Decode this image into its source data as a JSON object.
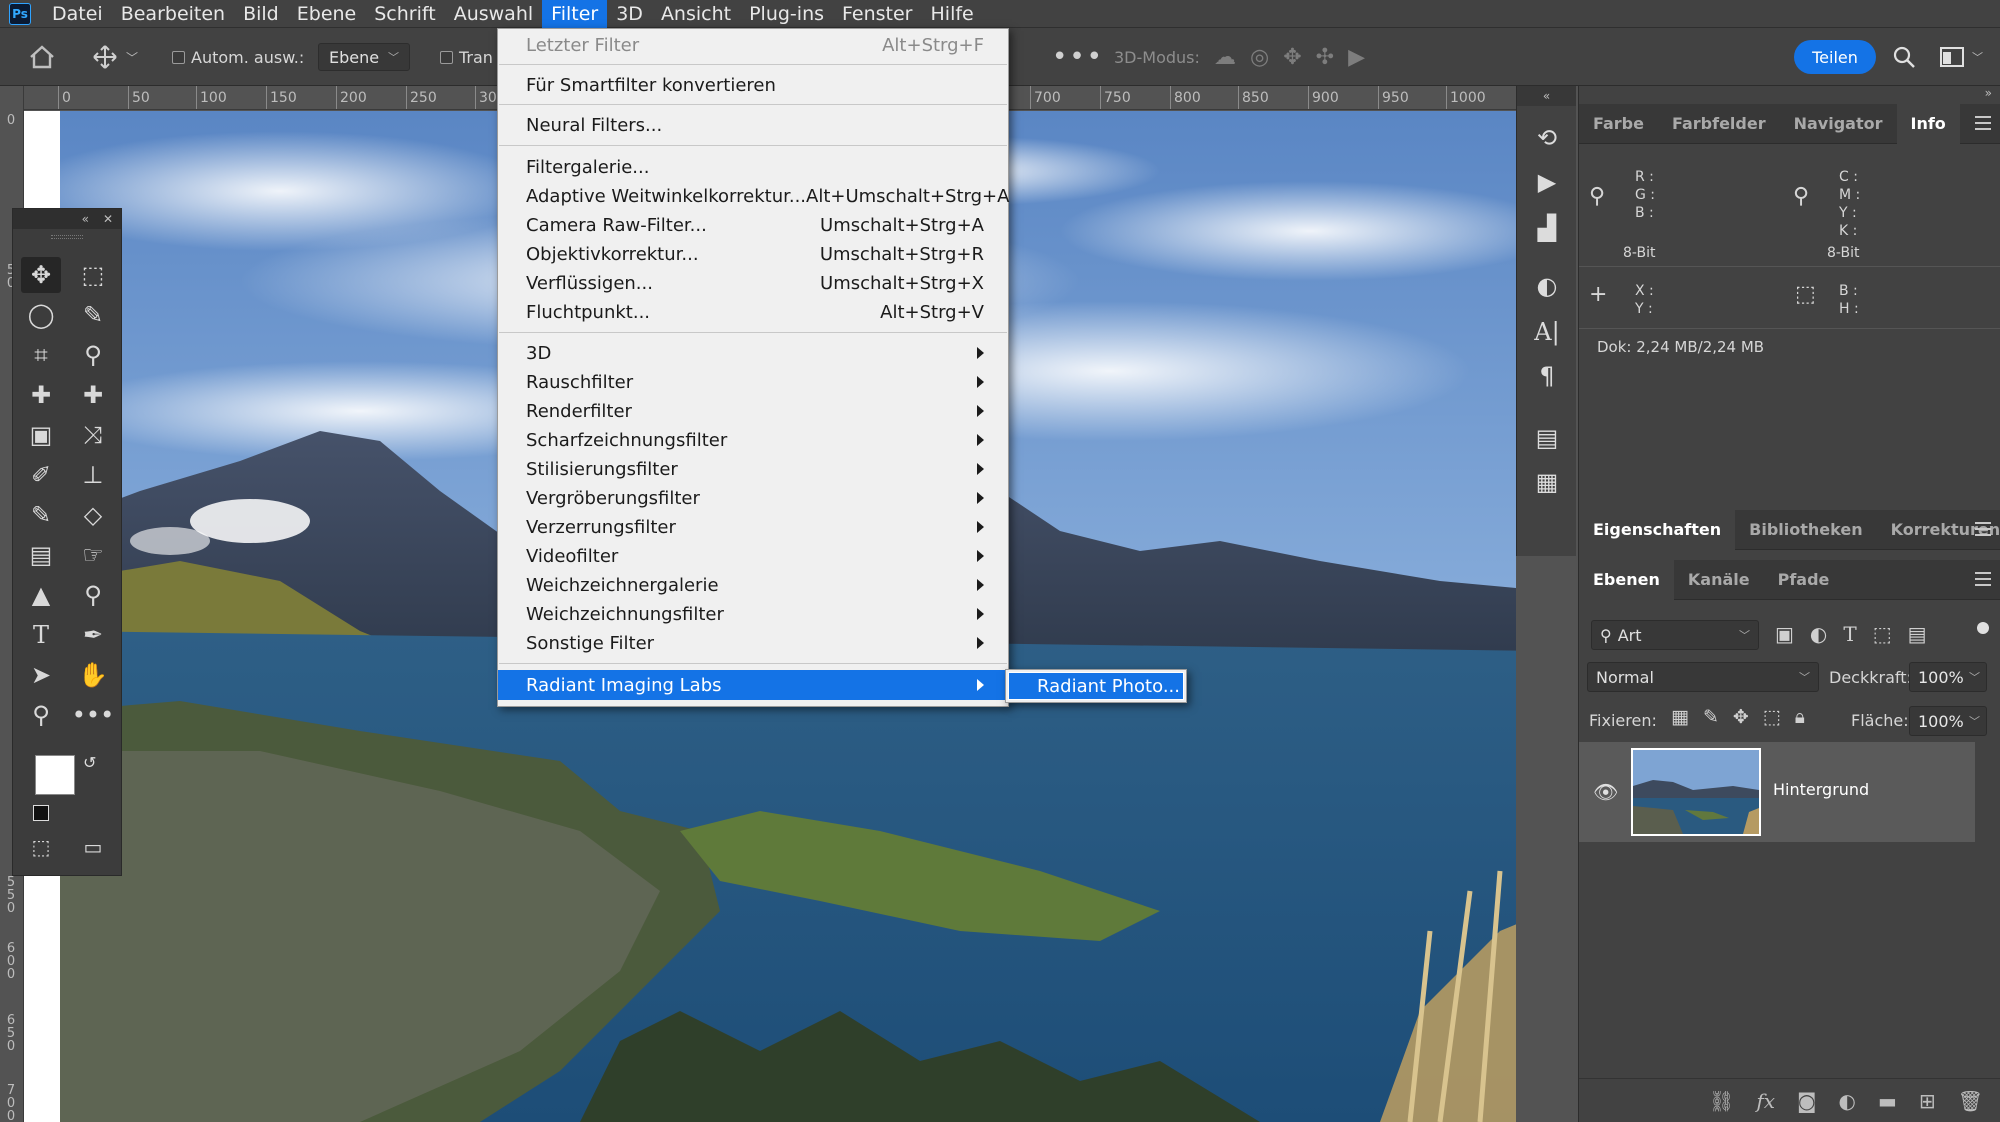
{
  "app": {
    "logo": "Ps"
  },
  "menubar": {
    "items": [
      "Datei",
      "Bearbeiten",
      "Bild",
      "Ebene",
      "Schrift",
      "Auswahl",
      "Filter",
      "3D",
      "Ansicht",
      "Plug-ins",
      "Fenster",
      "Hilfe"
    ],
    "active": "Filter"
  },
  "options": {
    "auto_select_label": "Autom. ausw.:",
    "layer_select": "Ebene",
    "transform_label": "Tran",
    "mode_label": "3D-Modus:",
    "share_label": "Teilen"
  },
  "ruler": {
    "top": [
      "0",
      "50",
      "100",
      "150",
      "200",
      "250",
      "30",
      "700",
      "750",
      "800",
      "850",
      "900",
      "950",
      "1000"
    ],
    "left": [
      "0",
      "50",
      "550",
      "600",
      "650",
      "700"
    ]
  },
  "filter_menu": {
    "items": [
      {
        "label": "Letzter Filter",
        "shortcut": "Alt+Strg+F",
        "disabled": true
      },
      {
        "label": "Für Smartfilter konvertieren",
        "shortcut": ""
      },
      {
        "label": "Neural Filters...",
        "shortcut": ""
      },
      {
        "label": "Filtergalerie...",
        "shortcut": ""
      },
      {
        "label": "Adaptive Weitwinkelkorrektur...",
        "shortcut": "Alt+Umschalt+Strg+A"
      },
      {
        "label": "Camera Raw-Filter...",
        "shortcut": "Umschalt+Strg+A"
      },
      {
        "label": "Objektivkorrektur...",
        "shortcut": "Umschalt+Strg+R"
      },
      {
        "label": "Verflüssigen...",
        "shortcut": "Umschalt+Strg+X"
      },
      {
        "label": "Fluchtpunkt...",
        "shortcut": "Alt+Strg+V"
      },
      {
        "label": "3D",
        "submenu": true
      },
      {
        "label": "Rauschfilter",
        "submenu": true
      },
      {
        "label": "Renderfilter",
        "submenu": true
      },
      {
        "label": "Scharfzeichnungsfilter",
        "submenu": true
      },
      {
        "label": "Stilisierungsfilter",
        "submenu": true
      },
      {
        "label": "Vergröberungsfilter",
        "submenu": true
      },
      {
        "label": "Verzerrungsfilter",
        "submenu": true
      },
      {
        "label": "Videofilter",
        "submenu": true
      },
      {
        "label": "Weichzeichnergalerie",
        "submenu": true
      },
      {
        "label": "Weichzeichnungsfilter",
        "submenu": true
      },
      {
        "label": "Sonstige Filter",
        "submenu": true
      },
      {
        "label": "Radiant Imaging Labs",
        "submenu": true,
        "highlighted": true
      }
    ],
    "submenu_item": "Radiant Photo..."
  },
  "info_panel": {
    "tabs": [
      "Farbe",
      "Farbfelder",
      "Navigator",
      "Info"
    ],
    "active_tab": "Info",
    "rgb_labels": "R :\nG :\nB :",
    "cmyk_labels": "C :\nM :\nY :\nK :",
    "bit_left": "8-Bit",
    "bit_right": "8-Bit",
    "xy_labels": "X :\nY :",
    "bh_labels": "B :\nH :",
    "doc": "Dok: 2,24 MB/2,24 MB"
  },
  "props_panel": {
    "tabs": [
      "Eigenschaften",
      "Bibliotheken",
      "Korrekturen"
    ],
    "active_tab": "Eigenschaften"
  },
  "layers_panel": {
    "tabs": [
      "Ebenen",
      "Kanäle",
      "Pfade"
    ],
    "active_tab": "Ebenen",
    "filter_kind": "Art",
    "blend_mode": "Normal",
    "opacity_label": "Deckkraft:",
    "opacity_value": "100%",
    "lock_label": "Fixieren:",
    "fill_label": "Fläche:",
    "fill_value": "100%",
    "layers": [
      {
        "name": "Hintergrund",
        "visible": true
      }
    ]
  },
  "colors": {
    "accent": "#1473e6",
    "panel": "#424242",
    "menu_bg": "#f0f0f0"
  }
}
